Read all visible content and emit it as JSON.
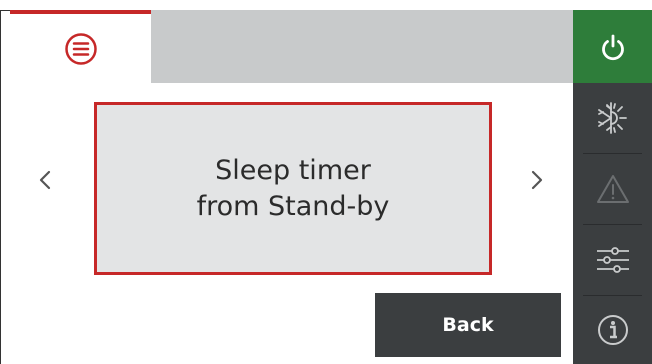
{
  "header": {
    "menu_icon": "hamburger-circle-icon",
    "accent_color": "#c62828"
  },
  "sidebar": {
    "items": [
      {
        "icon": "power-icon",
        "active": true,
        "color": "#2e7d3a"
      },
      {
        "icon": "heat-cool-mode-icon",
        "active": false
      },
      {
        "icon": "warning-icon",
        "active": false
      },
      {
        "icon": "settings-sliders-icon",
        "active": false
      },
      {
        "icon": "info-icon",
        "active": false
      }
    ]
  },
  "main": {
    "option_label": "Sleep timer\nfrom Stand-by",
    "prev_icon": "chevron-left-icon",
    "next_icon": "chevron-right-icon"
  },
  "footer": {
    "back_label": "Back"
  }
}
